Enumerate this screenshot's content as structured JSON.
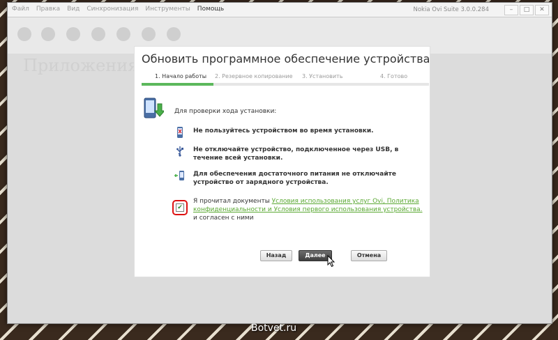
{
  "menu": [
    {
      "label": "Файл",
      "active": false
    },
    {
      "label": "Правка",
      "active": false
    },
    {
      "label": "Вид",
      "active": false
    },
    {
      "label": "Синхронизация",
      "active": false
    },
    {
      "label": "Инструменты",
      "active": false
    },
    {
      "label": "Помощь",
      "active": true
    }
  ],
  "app_title": "Nokia Ovi Suite 3.0.0.284",
  "window_controls": {
    "minimize": "–",
    "maximize": "□",
    "close": "✕"
  },
  "background_heading": "Приложения Ovi",
  "dialog": {
    "title": "Обновить программное обеспечение устройства",
    "steps": [
      {
        "label": "1. Начало работы",
        "current": true
      },
      {
        "label": "2. Резервное копирование",
        "current": false
      },
      {
        "label": "3. Установить",
        "current": false
      },
      {
        "label": "4. Готово",
        "current": false
      }
    ],
    "progress_fraction": 0.25,
    "intro": "Для проверки хода установки:",
    "items": [
      {
        "icon": "phone-warning-icon",
        "text": "Не пользуйтесь устройством во время установки."
      },
      {
        "icon": "usb-icon",
        "text": "Не отключайте устройство, подключенное через USB, в течение всей установки."
      },
      {
        "icon": "charger-icon",
        "text": "Для обеспечения достаточного питания не отключайте устройство от зарядного устройства."
      }
    ],
    "consent": {
      "checked": true,
      "prefix": "Я прочитал документы ",
      "link": "Условия использования услуг Ovi, Политика конфиденциальности и Условия первого использования устройства.",
      "suffix": " и согласен с ними"
    },
    "buttons": {
      "back": "Назад",
      "next": "Далее",
      "cancel": "Отмена"
    }
  },
  "watermark": "Botvet.ru"
}
